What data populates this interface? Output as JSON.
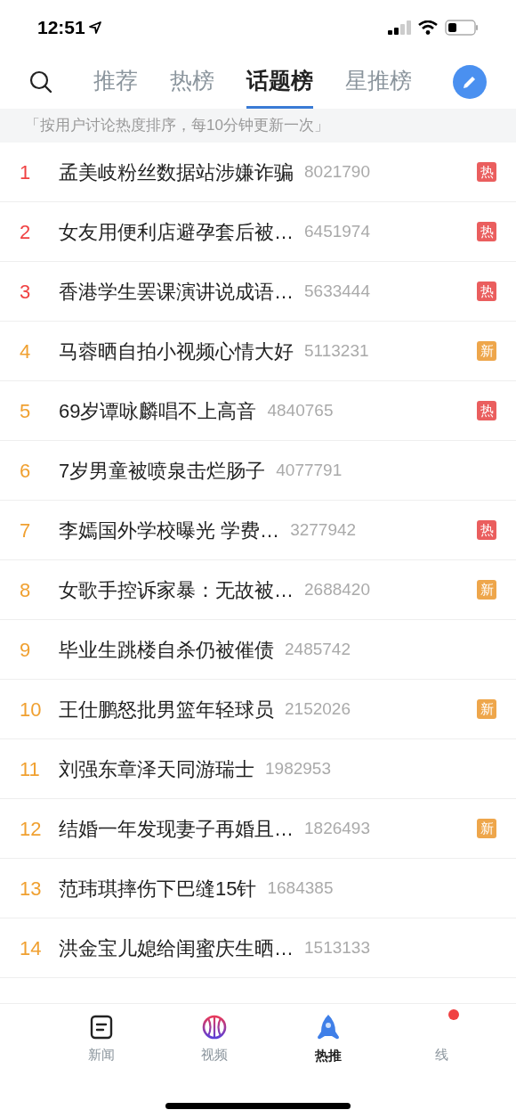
{
  "status_bar": {
    "time": "12:51"
  },
  "tabs": [
    {
      "label": "推荐",
      "selected": false
    },
    {
      "label": "热榜",
      "selected": false
    },
    {
      "label": "话题榜",
      "selected": true
    },
    {
      "label": "星推榜",
      "selected": false
    }
  ],
  "notice": "「按用户讨论热度排序，每10分钟更新一次」",
  "rows": [
    {
      "rank": "1",
      "color": "#f04142",
      "title": "孟美岐粉丝数据站涉嫌诈骗",
      "count": "8021790",
      "badge": {
        "text": "热",
        "kind": "hot"
      }
    },
    {
      "rank": "2",
      "color": "#f04142",
      "title": "女友用便利店避孕套后被…",
      "count": "6451974",
      "badge": {
        "text": "热",
        "kind": "hot"
      }
    },
    {
      "rank": "3",
      "color": "#f04142",
      "title": "香港学生罢课演讲说成语…",
      "count": "5633444",
      "badge": {
        "text": "热",
        "kind": "hot"
      }
    },
    {
      "rank": "4",
      "color": "#f0a030",
      "title": "马蓉晒自拍小视频心情大好",
      "count": "5113231",
      "badge": {
        "text": "新",
        "kind": "new"
      }
    },
    {
      "rank": "5",
      "color": "#f0a030",
      "title": "69岁谭咏麟唱不上高音",
      "count": "4840765",
      "badge": {
        "text": "热",
        "kind": "hot"
      }
    },
    {
      "rank": "6",
      "color": "#f0a030",
      "title": "7岁男童被喷泉击烂肠子",
      "count": "4077791"
    },
    {
      "rank": "7",
      "color": "#f0a030",
      "title": "李嫣国外学校曝光 学费…",
      "count": "3277942",
      "badge": {
        "text": "热",
        "kind": "hot"
      }
    },
    {
      "rank": "8",
      "color": "#f0a030",
      "title": "女歌手控诉家暴：无故被…",
      "count": "2688420",
      "badge": {
        "text": "新",
        "kind": "new"
      }
    },
    {
      "rank": "9",
      "color": "#f0a030",
      "title": "毕业生跳楼自杀仍被催债",
      "count": "2485742"
    },
    {
      "rank": "10",
      "color": "#f0a030",
      "title": "王仕鹏怒批男篮年轻球员",
      "count": "2152026",
      "badge": {
        "text": "新",
        "kind": "new"
      }
    },
    {
      "rank": "11",
      "color": "#f0a030",
      "title": "刘强东章泽天同游瑞士",
      "count": "1982953"
    },
    {
      "rank": "12",
      "color": "#f0a030",
      "title": "结婚一年发现妻子再婚且…",
      "count": "1826493",
      "badge": {
        "text": "新",
        "kind": "new"
      }
    },
    {
      "rank": "13",
      "color": "#f0a030",
      "title": "范玮琪摔伤下巴缝15针",
      "count": "1684385"
    },
    {
      "rank": "14",
      "color": "#f0a030",
      "title": "洪金宝儿媳给闺蜜庆生晒…",
      "count": "1513133"
    }
  ],
  "bottom_nav": [
    {
      "label": "新闻",
      "kind": "news",
      "selected": false
    },
    {
      "label": "视频",
      "kind": "video",
      "selected": false
    },
    {
      "label": "热推",
      "kind": "hot",
      "selected": true
    },
    {
      "label": "线",
      "kind": "other",
      "selected": false,
      "dot": true
    }
  ]
}
